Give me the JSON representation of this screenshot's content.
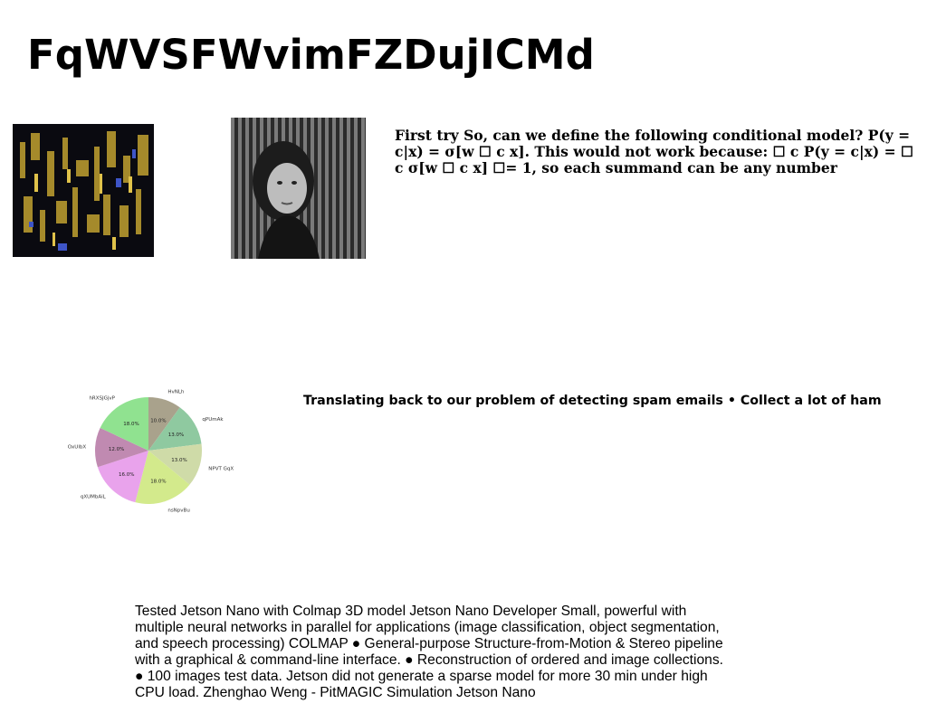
{
  "title": "FqWVSFWvimFZDujICMd",
  "images": {
    "abstract": "abstract-art",
    "portrait": "portrait-photo"
  },
  "conditional_model_text": "First try So, can we define the following conditional model? P(y = c|x) = σ[w ☐ c x]. This would not work because: ☐ c P(y = c|x) = ☐ c σ[w ☐ c x] ☐= 1, so each summand can be any number",
  "spam_text": "Translating back to our problem of detecting spam emails • Collect a lot of ham",
  "jetson_text": "Tested Jetson Nano with Colmap 3D model Jetson Nano Developer Small, powerful with multiple neural networks in parallel for applications (image classification, object segmentation, and speech processing) COLMAP ● General-purpose Structure-from-Motion & Stereo pipeline with a graphical & command-line interface. ● Reconstruction of ordered and image collections. ● 100 images test data. Jetson did not generate a sparse model for more 30 min under high CPU load. Zhenghao Weng - PitMAGIC Simulation Jetson Nano",
  "chart_data": {
    "type": "pie",
    "categories": [
      "HvNLh",
      "qPUmAk",
      "NPVT GqX",
      "nsNpvBu",
      "qXUMbAiL",
      "OxUlbX",
      "hRXSJGjvP"
    ],
    "values": [
      10.0,
      13.0,
      13.0,
      18.0,
      16.0,
      12.0,
      18.0
    ],
    "value_labels": [
      "10.0%",
      "13.0%",
      "13.0%",
      "18.0%",
      "16.0%",
      "12.0%",
      "18.0%"
    ],
    "colors": [
      "#a9a28c",
      "#8fc9a0",
      "#cfdba8",
      "#d3ea8c",
      "#e9a3ec",
      "#c08ab1",
      "#90e290"
    ],
    "start_angle": 90,
    "direction": "clockwise"
  }
}
